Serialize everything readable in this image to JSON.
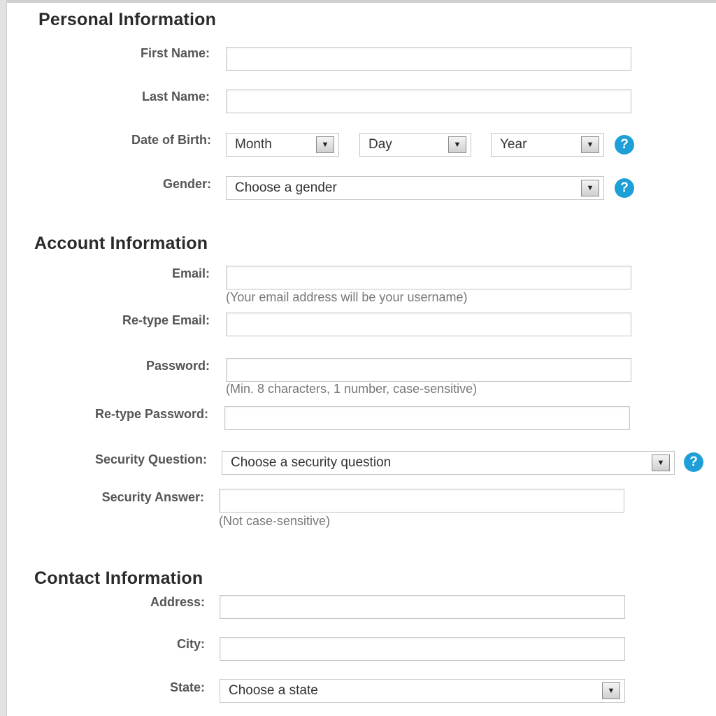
{
  "personal": {
    "heading": "Personal Information",
    "first_name_label": "First Name:",
    "last_name_label": "Last Name:",
    "dob_label": "Date of Birth:",
    "month": "Month",
    "day": "Day",
    "year": "Year",
    "gender_label": "Gender:",
    "gender_value": "Choose a gender"
  },
  "account": {
    "heading": "Account Information",
    "email_label": "Email:",
    "email_hint": "(Your email address will be your username)",
    "retype_email_label": "Re-type Email:",
    "password_label": "Password:",
    "password_hint": "(Min. 8 characters, 1 number, case-sensitive)",
    "retype_password_label": "Re-type Password:",
    "security_question_label": "Security Question:",
    "security_question_value": "Choose a security question",
    "security_answer_label": "Security Answer:",
    "security_answer_hint": "(Not case-sensitive)"
  },
  "contact": {
    "heading": "Contact Information",
    "address_label": "Address:",
    "city_label": "City:",
    "state_label": "State:",
    "state_value": "Choose a state"
  },
  "icons": {
    "help_glyph": "?",
    "dropdown_glyph": "▼"
  },
  "colors": {
    "help_icon": "#1e9fd8"
  }
}
